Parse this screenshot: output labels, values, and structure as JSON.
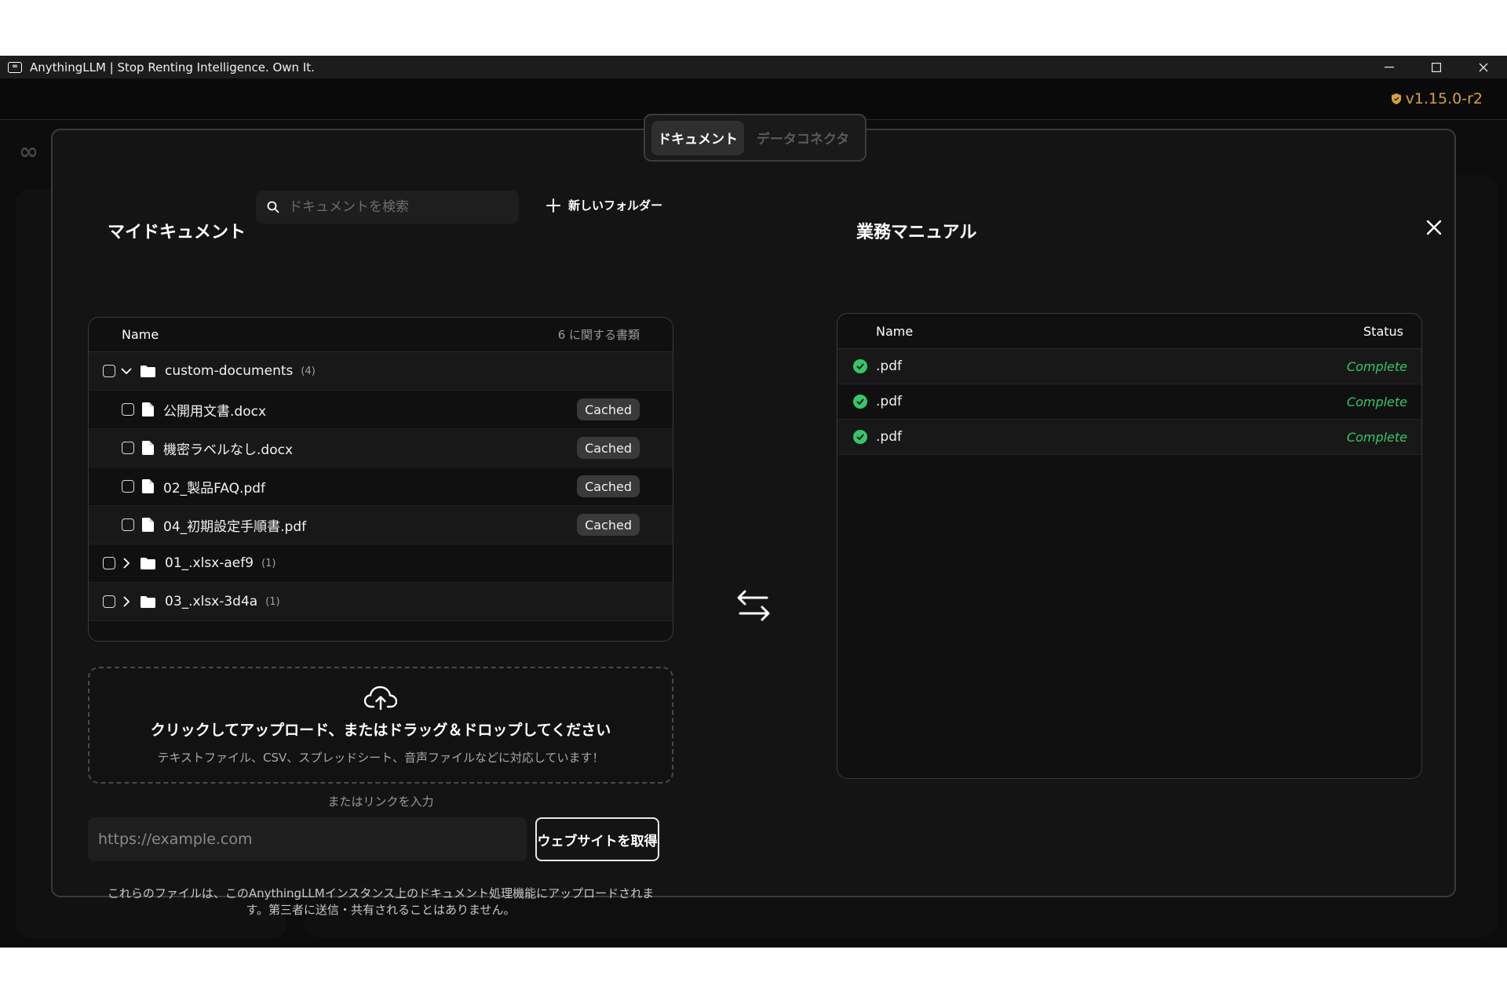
{
  "window": {
    "title": "AnythingLLM | Stop Renting Intelligence. Own It.",
    "logo_text": "∞",
    "minimize": "—",
    "maximize": "☐",
    "close": "✕"
  },
  "header": {
    "version": "v1.15.0-r2"
  },
  "modal": {
    "tabs": [
      {
        "label": "ドキュメント",
        "active": true
      },
      {
        "label": "データコネクタ",
        "active": false
      }
    ],
    "close_glyph": "✕"
  },
  "my_documents": {
    "title": "マイドキュメント",
    "search_placeholder": "ドキュメントを検索",
    "new_folder_label": "新しいフォルダー",
    "table": {
      "name_header": "Name",
      "count_label": "6 に関する書類",
      "rows": [
        {
          "type": "folder",
          "name": "custom-documents",
          "count": "(4)",
          "expanded": true
        },
        {
          "type": "file",
          "name": "公開用文書.docx",
          "badge": "Cached"
        },
        {
          "type": "file",
          "name": "機密ラベルなし.docx",
          "badge": "Cached"
        },
        {
          "type": "file",
          "name": "02_製品FAQ.pdf",
          "badge": "Cached"
        },
        {
          "type": "file",
          "name": "04_初期設定手順書.pdf",
          "badge": "Cached"
        },
        {
          "type": "folder",
          "name": "01_.xlsx-aef9",
          "count": "(1)",
          "expanded": false
        },
        {
          "type": "folder",
          "name": "03_.xlsx-3d4a",
          "count": "(1)",
          "expanded": false
        }
      ]
    }
  },
  "upload": {
    "title": "クリックしてアップロード、またはドラッグ＆ドロップしてください",
    "subtitle": "テキストファイル、CSV、スプレッドシート、音声ファイルなどに対応しています！",
    "or_link": "またはリンクを入力",
    "url_placeholder": "https://example.com",
    "fetch_label": "ウェブサイトを取得",
    "disclaimer_line1": "これらのファイルは、このAnythingLLMインスタンス上のドキュメント処理機能にアップロードされま",
    "disclaimer_line2": "す。第三者に送信・共有されることはありません。"
  },
  "workspace": {
    "title": "業務マニュアル",
    "name_header": "Name",
    "status_header": "Status",
    "rows": [
      {
        "name": ".pdf",
        "status": "Complete"
      },
      {
        "name": ".pdf",
        "status": "Complete"
      },
      {
        "name": ".pdf",
        "status": "Complete"
      }
    ]
  },
  "colors": {
    "accent_green": "#34c76a",
    "version_gold": "#d4a23a",
    "background": "#0c0c0c",
    "modal": "#141414"
  },
  "icons": {
    "search": "search-icon",
    "plus": "plus-icon",
    "folder": "folder-icon",
    "file": "file-icon",
    "upload": "cloud-upload-icon",
    "swap": "swap-arrows-icon",
    "check": "check-circle-icon",
    "shield": "shield-icon"
  }
}
